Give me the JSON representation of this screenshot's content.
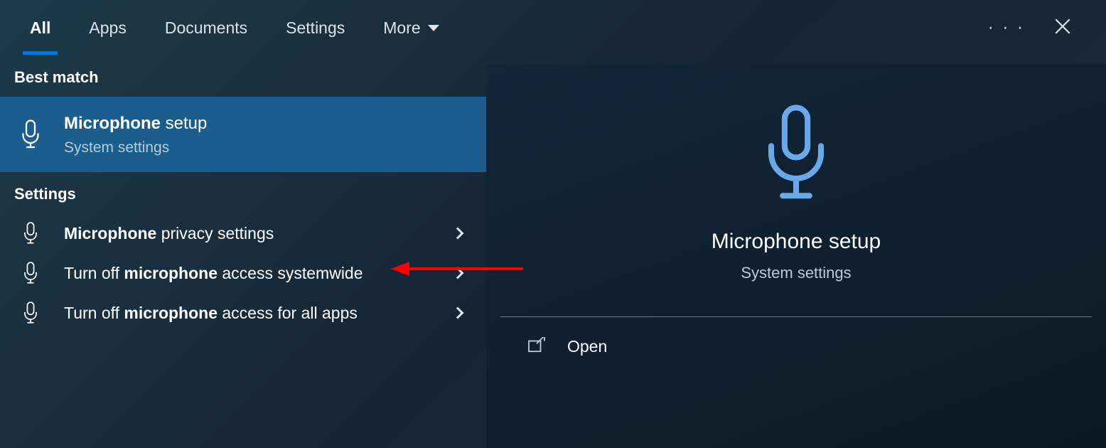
{
  "tabs": {
    "all": "All",
    "apps": "Apps",
    "documents": "Documents",
    "settings": "Settings",
    "more": "More"
  },
  "sections": {
    "best_match": "Best match",
    "settings": "Settings"
  },
  "best_match_item": {
    "title_bold": "Microphone",
    "title_rest": " setup",
    "subtitle": "System settings"
  },
  "settings_items": [
    {
      "bold": "Microphone",
      "rest": " privacy settings"
    },
    {
      "pre": "Turn off ",
      "bold": "microphone",
      "rest": " access systemwide"
    },
    {
      "pre": "Turn off ",
      "bold": "microphone",
      "rest": " access for all apps"
    }
  ],
  "detail": {
    "title": "Microphone setup",
    "subtitle": "System settings",
    "open": "Open"
  },
  "icons": {
    "microphone": "microphone-icon",
    "open": "open-icon",
    "close": "close-icon",
    "more_menu": "more-dots-icon",
    "chevron_down": "chevron-down-icon",
    "chevron_right": "chevron-right-icon"
  },
  "colors": {
    "accent": "#0078d4",
    "icon_blue": "#6aa8e8",
    "arrow": "#ff0000"
  }
}
